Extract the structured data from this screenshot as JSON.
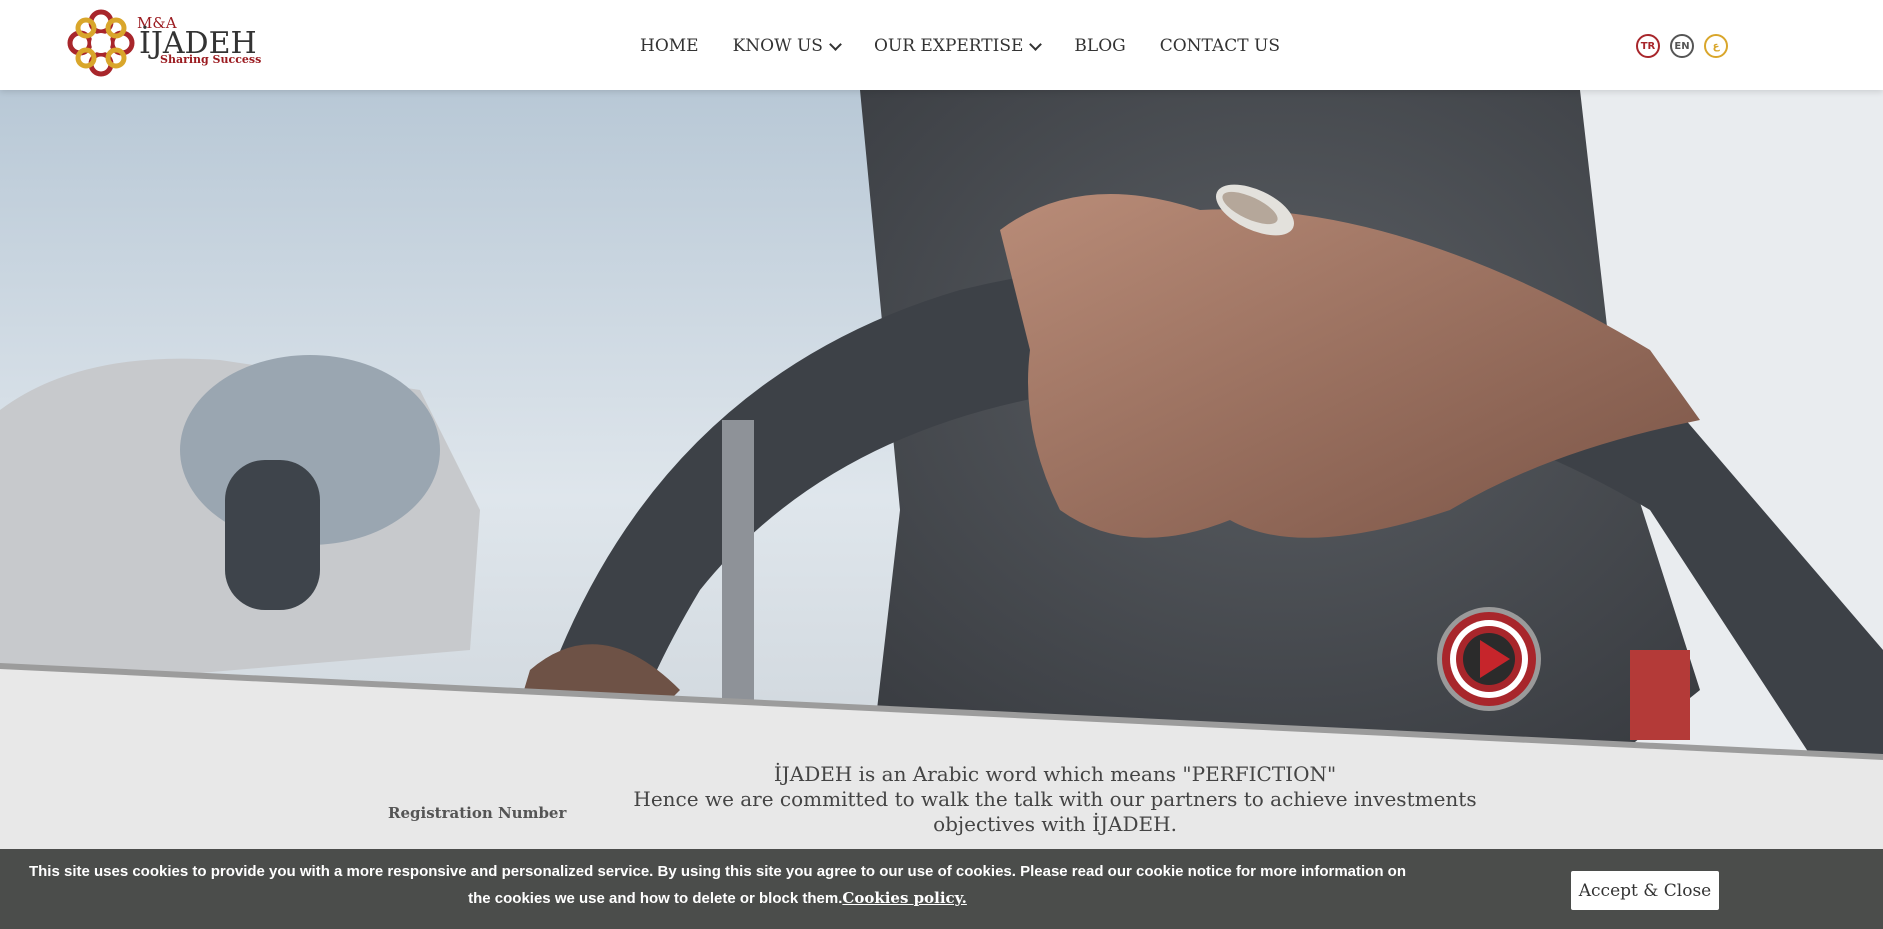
{
  "brand": {
    "prefix": "M&A",
    "name": "İJADEH",
    "tagline": "Sharing Success"
  },
  "nav": {
    "items": [
      {
        "label": "HOME",
        "has_dropdown": false
      },
      {
        "label": "KNOW US",
        "has_dropdown": true
      },
      {
        "label": "OUR EXPERTISE",
        "has_dropdown": true
      },
      {
        "label": "BLOG",
        "has_dropdown": false
      },
      {
        "label": "CONTACT US",
        "has_dropdown": false
      }
    ]
  },
  "languages": [
    {
      "code": "TR",
      "color": "#a8262b"
    },
    {
      "code": "EN",
      "color": "#555555"
    },
    {
      "code": "ع",
      "color": "#d9a62b"
    }
  ],
  "intro": {
    "line1": "İJADEH is an Arabic word which means \"PERFICTION\"",
    "line2": "Hence we are committed to walk the talk with our partners to achieve investments objectives with İJADEH."
  },
  "registration_label": "Registration Number",
  "cookie": {
    "text": "This site uses cookies to provide you with a more responsive and personalized service. By using this site you agree to our use of cookies. Please read our cookie notice for more information on the cookies we use and how to delete or block them.",
    "link": "Cookies policy.",
    "accept": "Accept & Close"
  },
  "colors": {
    "brand_red": "#a8262b",
    "cookie_bg": "#4b4d4b"
  }
}
